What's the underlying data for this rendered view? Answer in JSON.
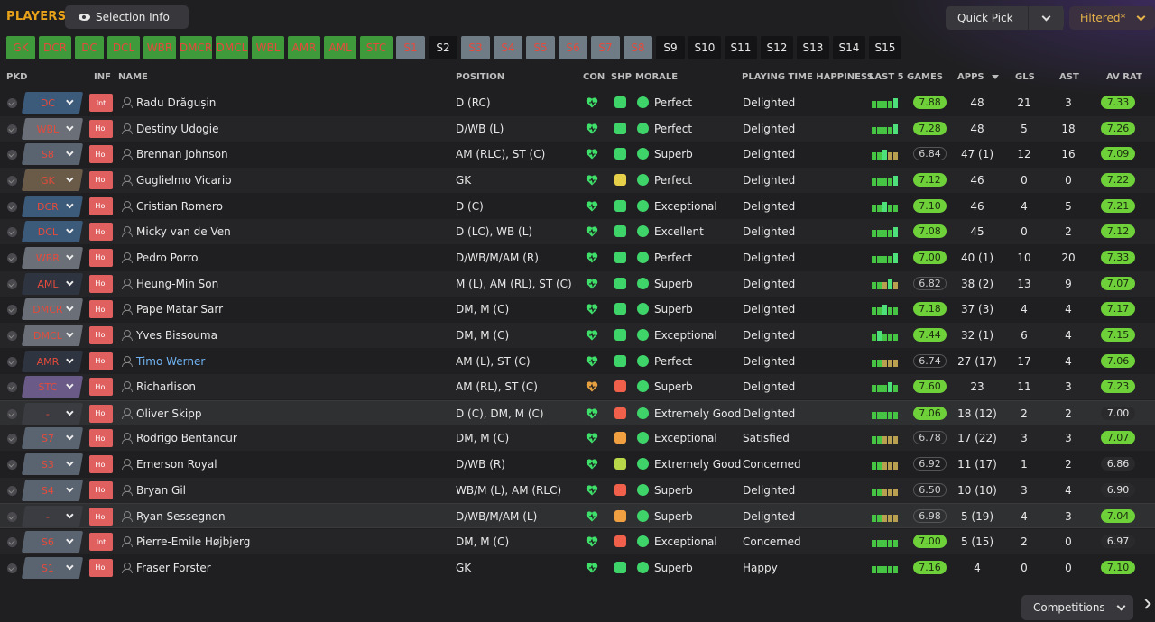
{
  "title": "PLAYERS",
  "selection_info": "Selection Info",
  "quick_pick": "Quick Pick",
  "filtered": "Filtered*",
  "competitions": "Competitions",
  "positions": [
    {
      "label": "GK",
      "style": "g"
    },
    {
      "label": "DCR",
      "style": "g"
    },
    {
      "label": "DC",
      "style": "g"
    },
    {
      "label": "DCL",
      "style": "g"
    },
    {
      "label": "WBR",
      "style": "g"
    },
    {
      "label": "DMCR",
      "style": "g"
    },
    {
      "label": "DMCL",
      "style": "g"
    },
    {
      "label": "WBL",
      "style": "g"
    },
    {
      "label": "AMR",
      "style": "g"
    },
    {
      "label": "AML",
      "style": "g"
    },
    {
      "label": "STC",
      "style": "g"
    },
    {
      "label": "S1",
      "style": "gr"
    },
    {
      "label": "S2",
      "style": "d"
    },
    {
      "label": "S3",
      "style": "gr"
    },
    {
      "label": "S4",
      "style": "gr"
    },
    {
      "label": "S5",
      "style": "gr"
    },
    {
      "label": "S6",
      "style": "gr"
    },
    {
      "label": "S7",
      "style": "gr"
    },
    {
      "label": "S8",
      "style": "gr"
    },
    {
      "label": "S9",
      "style": "d"
    },
    {
      "label": "S10",
      "style": "d"
    },
    {
      "label": "S11",
      "style": "d"
    },
    {
      "label": "S12",
      "style": "d"
    },
    {
      "label": "S13",
      "style": "d"
    },
    {
      "label": "S14",
      "style": "d"
    },
    {
      "label": "S15",
      "style": "d"
    }
  ],
  "headers": {
    "pkd": "PKD",
    "inf": "INF",
    "name": "NAME",
    "position": "POSITION",
    "con": "CON",
    "shp": "SHP",
    "morale": "MORALE",
    "pth": "PLAYING TIME HAPPINESS",
    "last5": "LAST 5 GAMES",
    "apps": "APPS",
    "gls": "GLS",
    "ast": "AST",
    "avrat": "AV RAT"
  },
  "players": [
    {
      "pkd": "DC",
      "pkd_color": "#3c5a7a",
      "inf": "Int",
      "name": "Radu Drăgușin",
      "position": "D (RC)",
      "con": "#3fe06a",
      "shp": "#3fd46a",
      "morale": "Perfect",
      "happiness": "Delighted",
      "form": [
        8,
        8,
        8,
        8,
        11
      ],
      "last5": "7.88",
      "last5_hi": true,
      "apps": "48",
      "gls": "21",
      "ast": "3",
      "avrat": "7.33",
      "avrat_hi": true
    },
    {
      "pkd": "WBL",
      "pkd_color": "#6a6f78",
      "inf": "Hol",
      "name": "Destiny Udogie",
      "position": "D/WB (L)",
      "con": "#3fe06a",
      "shp": "#3fd46a",
      "morale": "Perfect",
      "happiness": "Delighted",
      "form": [
        8,
        8,
        8,
        8,
        11
      ],
      "last5": "7.28",
      "last5_hi": true,
      "apps": "48",
      "gls": "5",
      "ast": "18",
      "avrat": "7.26",
      "avrat_hi": true
    },
    {
      "pkd": "S8",
      "pkd_color": "#5a6470",
      "inf": "Hol",
      "name": "Brennan Johnson",
      "position": "AM (RLC), ST (C)",
      "con": "#3fe06a",
      "shp": "#3fd46a",
      "morale": "Superb",
      "happiness": "Delighted",
      "form": [
        8,
        8,
        11,
        8,
        8
      ],
      "last5": "6.84",
      "last5_hi": false,
      "apps": "47 (1)",
      "gls": "12",
      "ast": "16",
      "avrat": "7.09",
      "avrat_hi": true
    },
    {
      "pkd": "GK",
      "pkd_color": "#6a5a48",
      "inf": "Hol",
      "name": "Guglielmo Vicario",
      "position": "GK",
      "con": "#3fe06a",
      "shp": "#e6d04a",
      "morale": "Perfect",
      "happiness": "Delighted",
      "form": [
        8,
        8,
        8,
        8,
        11
      ],
      "last5": "7.12",
      "last5_hi": true,
      "apps": "46",
      "gls": "0",
      "ast": "0",
      "avrat": "7.22",
      "avrat_hi": true
    },
    {
      "pkd": "DCR",
      "pkd_color": "#3c5a7a",
      "inf": "Hol",
      "name": "Cristian Romero",
      "position": "D (C)",
      "con": "#3fe06a",
      "shp": "#3fd46a",
      "morale": "Exceptional",
      "happiness": "Delighted",
      "form": [
        8,
        8,
        11,
        8,
        8
      ],
      "last5": "7.10",
      "last5_hi": true,
      "apps": "46",
      "gls": "4",
      "ast": "5",
      "avrat": "7.21",
      "avrat_hi": true
    },
    {
      "pkd": "DCL",
      "pkd_color": "#3c5a7a",
      "inf": "Hol",
      "name": "Micky van de Ven",
      "position": "D (LC), WB (L)",
      "con": "#3fe06a",
      "shp": "#3fd46a",
      "morale": "Excellent",
      "happiness": "Delighted",
      "form": [
        8,
        8,
        8,
        8,
        11
      ],
      "last5": "7.08",
      "last5_hi": true,
      "apps": "45",
      "gls": "0",
      "ast": "2",
      "avrat": "7.12",
      "avrat_hi": true
    },
    {
      "pkd": "WBR",
      "pkd_color": "#6a6f78",
      "inf": "Hol",
      "name": "Pedro Porro",
      "position": "D/WB/M/AM (R)",
      "con": "#3fe06a",
      "shp": "#3fd46a",
      "morale": "Perfect",
      "happiness": "Delighted",
      "form": [
        8,
        8,
        8,
        8,
        11
      ],
      "last5": "7.00",
      "last5_hi": true,
      "apps": "40 (1)",
      "gls": "10",
      "ast": "20",
      "avrat": "7.33",
      "avrat_hi": true
    },
    {
      "pkd": "AML",
      "pkd_color": "#2e3440",
      "inf": "Hol",
      "name": "Heung-Min Son",
      "position": "M (L), AM (RL), ST (C)",
      "con": "#3fe06a",
      "shp": "#3fd46a",
      "morale": "Superb",
      "happiness": "Delighted",
      "form": [
        8,
        8,
        8,
        11,
        8
      ],
      "last5": "6.82",
      "last5_hi": false,
      "apps": "38 (2)",
      "gls": "13",
      "ast": "9",
      "avrat": "7.07",
      "avrat_hi": true
    },
    {
      "pkd": "DMCR",
      "pkd_color": "#6a6f78",
      "inf": "Hol",
      "name": "Pape Matar Sarr",
      "position": "DM, M (C)",
      "con": "#3fe06a",
      "shp": "#3fd46a",
      "morale": "Superb",
      "happiness": "Delighted",
      "form": [
        8,
        8,
        11,
        8,
        8
      ],
      "last5": "7.18",
      "last5_hi": true,
      "apps": "37 (3)",
      "gls": "4",
      "ast": "4",
      "avrat": "7.17",
      "avrat_hi": true
    },
    {
      "pkd": "DMCL",
      "pkd_color": "#6a6f78",
      "inf": "Hol",
      "name": "Yves Bissouma",
      "position": "DM, M (C)",
      "con": "#3fe06a",
      "shp": "#3fd46a",
      "morale": "Exceptional",
      "happiness": "Delighted",
      "form": [
        8,
        11,
        8,
        8,
        8
      ],
      "last5": "7.44",
      "last5_hi": true,
      "apps": "32 (1)",
      "gls": "6",
      "ast": "4",
      "avrat": "7.15",
      "avrat_hi": true
    },
    {
      "pkd": "AMR",
      "pkd_color": "#2e3440",
      "inf": "Hol",
      "name": "Timo Werner",
      "position": "AM (L), ST (C)",
      "con": "#3fe06a",
      "shp": "#3fd46a",
      "morale": "Perfect",
      "happiness": "Delighted",
      "form": [
        8,
        8,
        8,
        8,
        8
      ],
      "last5": "6.74",
      "last5_hi": false,
      "apps": "27 (17)",
      "gls": "17",
      "ast": "4",
      "avrat": "7.06",
      "avrat_hi": true,
      "blue": true
    },
    {
      "pkd": "STC",
      "pkd_color": "#6a5a88",
      "inf": "Hol",
      "name": "Richarlison",
      "position": "AM (RL), ST (C)",
      "con": "#e6a040",
      "shp": "#f0604a",
      "morale": "Superb",
      "happiness": "Delighted",
      "form": [
        8,
        8,
        8,
        11,
        8
      ],
      "last5": "7.60",
      "last5_hi": true,
      "apps": "23",
      "gls": "11",
      "ast": "3",
      "avrat": "7.23",
      "avrat_hi": true
    },
    {
      "pkd": "-",
      "pkd_color": "#3a3c42",
      "inf": "Hol",
      "name": "Oliver Skipp",
      "position": "D (C), DM, M (C)",
      "con": "#3fe06a",
      "shp": "#f0604a",
      "morale": "Extremely Good",
      "happiness": "Delighted",
      "form": [
        8,
        8,
        8,
        8,
        8
      ],
      "last5": "7.06",
      "last5_hi": true,
      "apps": "18 (12)",
      "gls": "2",
      "ast": "2",
      "avrat": "7.00",
      "avrat_hi": false,
      "hl": true
    },
    {
      "pkd": "S7",
      "pkd_color": "#5a6470",
      "inf": "Hol",
      "name": "Rodrigo Bentancur",
      "position": "DM, M (C)",
      "con": "#3fe06a",
      "shp": "#f0a040",
      "morale": "Exceptional",
      "happiness": "Satisfied",
      "form": [
        8,
        8,
        8,
        8,
        8
      ],
      "last5": "6.78",
      "last5_hi": false,
      "apps": "17 (22)",
      "gls": "3",
      "ast": "3",
      "avrat": "7.07",
      "avrat_hi": true
    },
    {
      "pkd": "S3",
      "pkd_color": "#5a6470",
      "inf": "Hol",
      "name": "Emerson Royal",
      "position": "D/WB (R)",
      "con": "#3fe06a",
      "shp": "#b8d84a",
      "morale": "Extremely Good",
      "happiness": "Concerned",
      "form": [
        8,
        8,
        8,
        8,
        8
      ],
      "last5": "6.92",
      "last5_hi": false,
      "apps": "11 (17)",
      "gls": "1",
      "ast": "2",
      "avrat": "6.86",
      "avrat_hi": false
    },
    {
      "pkd": "S4",
      "pkd_color": "#5a6470",
      "inf": "Hol",
      "name": "Bryan Gil",
      "position": "WB/M (L), AM (RLC)",
      "con": "#3fe06a",
      "shp": "#f0604a",
      "morale": "Superb",
      "happiness": "Delighted",
      "form": [
        8,
        8,
        8,
        8,
        8
      ],
      "last5": "6.50",
      "last5_hi": false,
      "apps": "10 (10)",
      "gls": "3",
      "ast": "4",
      "avrat": "6.90",
      "avrat_hi": false
    },
    {
      "pkd": "-",
      "pkd_color": "#3a3c42",
      "inf": "Hol",
      "name": "Ryan Sessegnon",
      "position": "D/WB/M/AM (L)",
      "con": "#3fe06a",
      "shp": "#f0a040",
      "morale": "Superb",
      "happiness": "Delighted",
      "form": [
        8,
        8,
        8,
        8,
        8
      ],
      "last5": "6.98",
      "last5_hi": false,
      "apps": "5 (19)",
      "gls": "4",
      "ast": "3",
      "avrat": "7.04",
      "avrat_hi": true,
      "hl": true
    },
    {
      "pkd": "S6",
      "pkd_color": "#5a6470",
      "inf": "Int",
      "name": "Pierre-Emile Højbjerg",
      "position": "DM, M (C)",
      "con": "#3fe06a",
      "shp": "#f0604a",
      "morale": "Exceptional",
      "happiness": "Concerned",
      "form": [
        8,
        8,
        8,
        8,
        8
      ],
      "last5": "7.00",
      "last5_hi": true,
      "apps": "5 (15)",
      "gls": "2",
      "ast": "0",
      "avrat": "6.97",
      "avrat_hi": false
    },
    {
      "pkd": "S1",
      "pkd_color": "#5a6470",
      "inf": "Hol",
      "name": "Fraser Forster",
      "position": "GK",
      "con": "#3fe06a",
      "shp": "#3fd46a",
      "morale": "Superb",
      "happiness": "Happy",
      "form": [
        8,
        8,
        8,
        8,
        8
      ],
      "last5": "7.16",
      "last5_hi": true,
      "apps": "4",
      "gls": "0",
      "ast": "0",
      "avrat": "7.10",
      "avrat_hi": true
    }
  ]
}
